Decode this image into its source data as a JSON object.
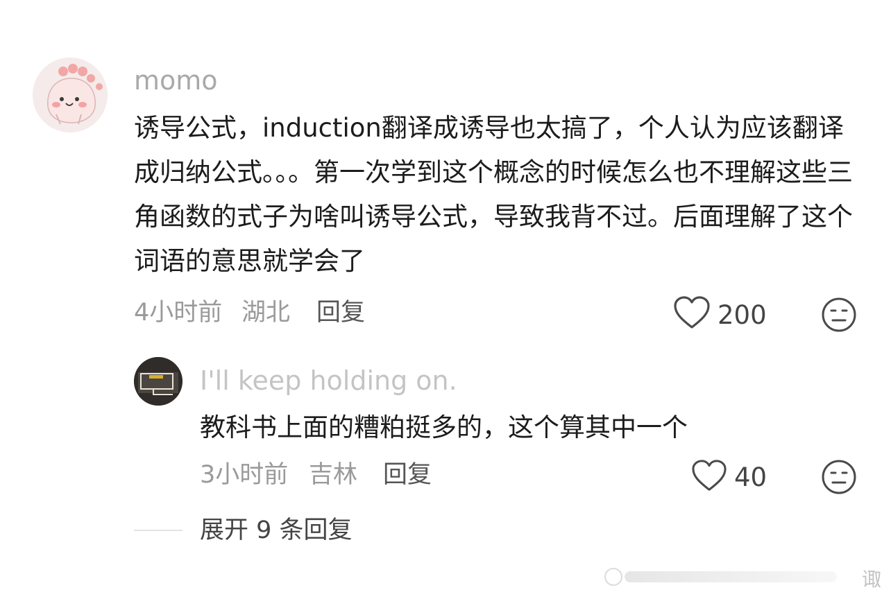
{
  "comment": {
    "username": "momo",
    "text": "诱导公式，induction翻译成诱导也太搞了，个人认为应该翻译成归纳公式。。。第一次学到这个概念的时候怎么也不理解这些三角函数的式子为啥叫诱导公式，导致我背不过。后面理解了这个词语的意思就学会了",
    "time": "4小时前",
    "location": "湖北",
    "reply_label": "回复",
    "likes": "200",
    "like_icon": "heart-outline-icon",
    "dislike_icon": "meh-face-icon"
  },
  "reply": {
    "username": "I'll keep holding on.",
    "text": "教科书上面的糟粕挺多的，这个算其中一个",
    "time": "3小时前",
    "location": "吉林",
    "reply_label": "回复",
    "likes": "40",
    "like_icon": "heart-outline-icon",
    "dislike_icon": "meh-face-icon"
  },
  "expand_label": "展开 9 条回复",
  "watermark": {
    "text": "诹"
  }
}
